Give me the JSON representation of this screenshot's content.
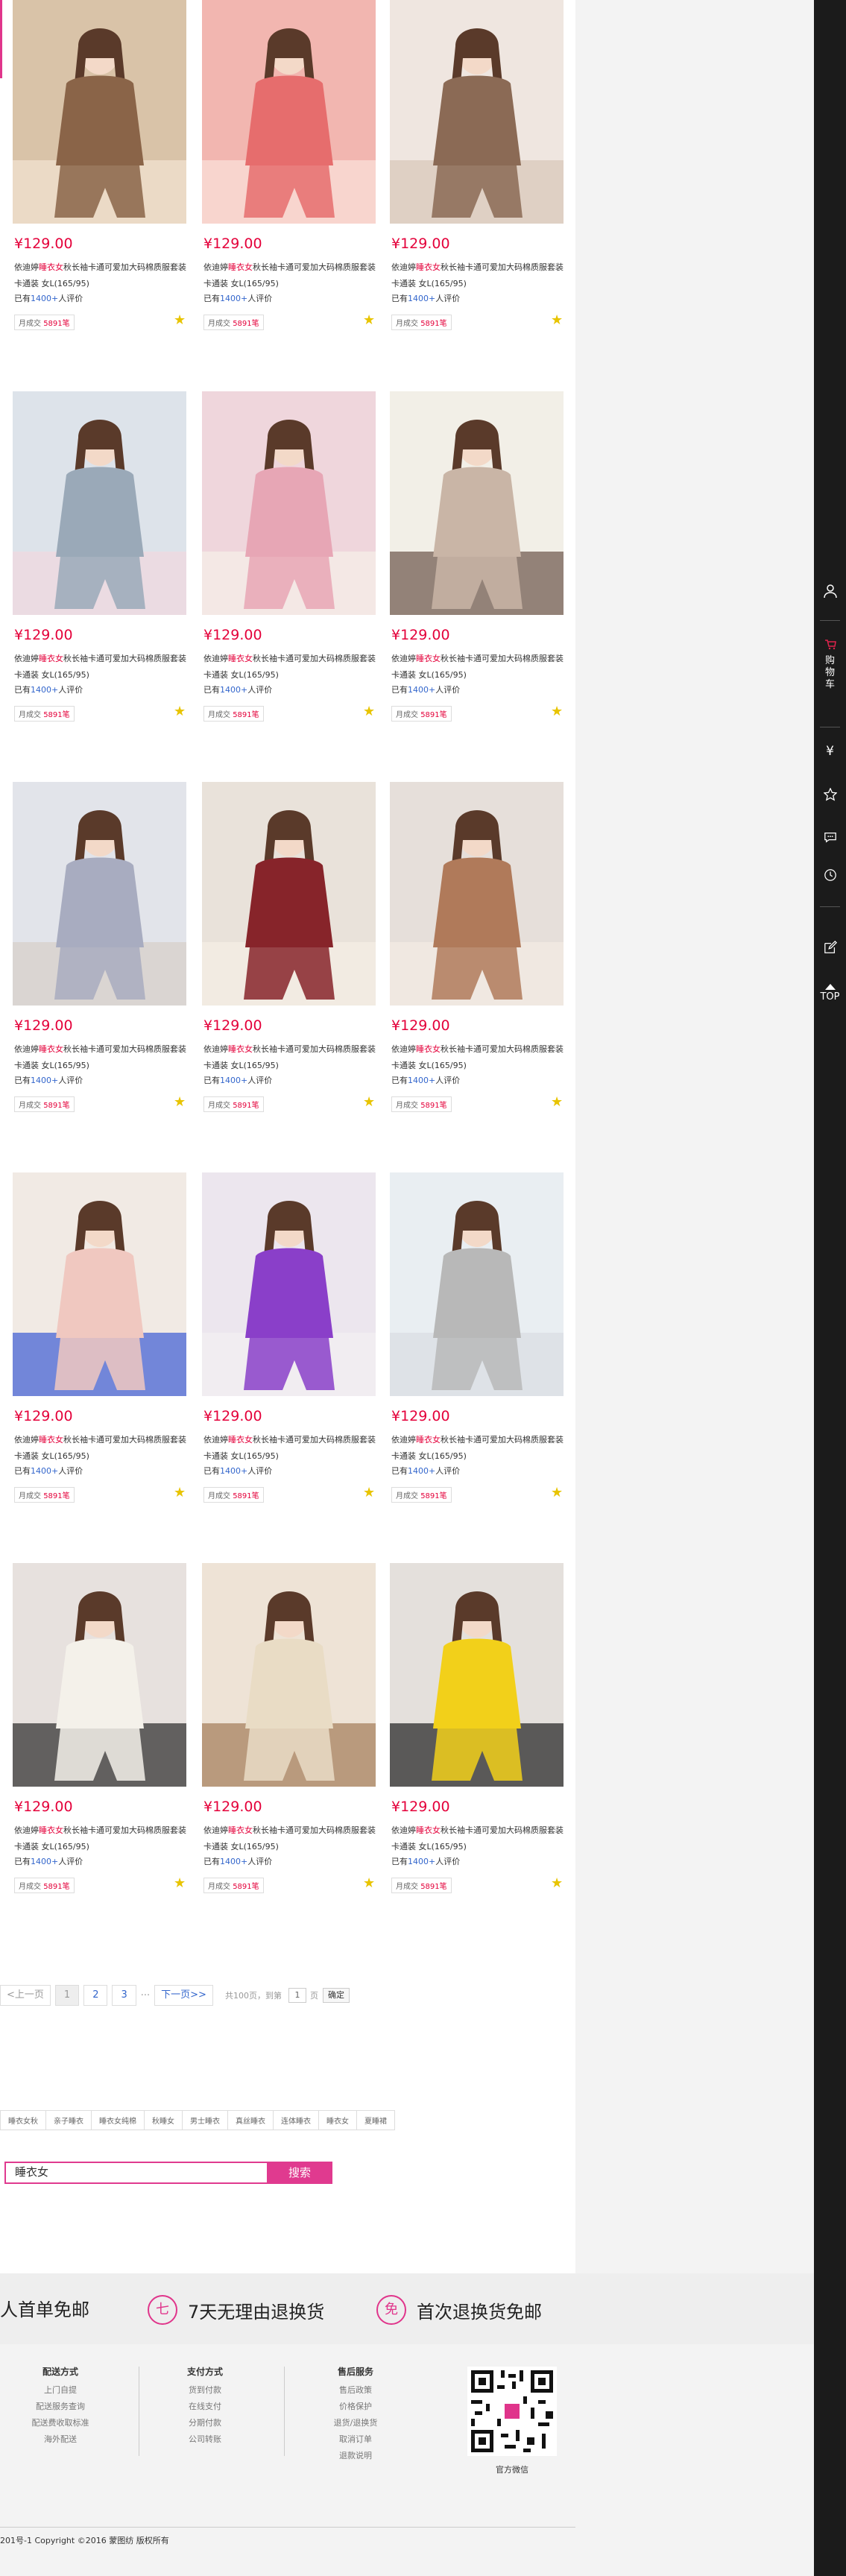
{
  "products": [
    {
      "price": "¥129.00",
      "desc_pre": "依迪婷",
      "desc_hl": "睡衣女",
      "desc_post": "秋长袖卡通可爱加大码棉质服套装 卡通装 女L(165/95)",
      "reviews_pre": "已有",
      "reviews_num": "1400+",
      "reviews_post": "人评价",
      "sold_label": "月成交",
      "sold_num": "5891笔"
    },
    {
      "price": "¥129.00",
      "desc_pre": "依迪婷",
      "desc_hl": "睡衣女",
      "desc_post": "秋长袖卡通可爱加大码棉质服套装 卡通装 女L(165/95)",
      "reviews_pre": "已有",
      "reviews_num": "1400+",
      "reviews_post": "人评价",
      "sold_label": "月成交",
      "sold_num": "5891笔"
    },
    {
      "price": "¥129.00",
      "desc_pre": "依迪婷",
      "desc_hl": "睡衣女",
      "desc_post": "秋长袖卡通可爱加大码棉质服套装 卡通装 女L(165/95)",
      "reviews_pre": "已有",
      "reviews_num": "1400+",
      "reviews_post": "人评价",
      "sold_label": "月成交",
      "sold_num": "5891笔"
    },
    {
      "price": "¥129.00",
      "desc_pre": "依迪婷",
      "desc_hl": "睡衣女",
      "desc_post": "秋长袖卡通可爱加大码棉质服套装 卡通装 女L(165/95)",
      "reviews_pre": "已有",
      "reviews_num": "1400+",
      "reviews_post": "人评价",
      "sold_label": "月成交",
      "sold_num": "5891笔"
    },
    {
      "price": "¥129.00",
      "desc_pre": "依迪婷",
      "desc_hl": "睡衣女",
      "desc_post": "秋长袖卡通可爱加大码棉质服套装 卡通装 女L(165/95)",
      "reviews_pre": "已有",
      "reviews_num": "1400+",
      "reviews_post": "人评价",
      "sold_label": "月成交",
      "sold_num": "5891笔"
    },
    {
      "price": "¥129.00",
      "desc_pre": "依迪婷",
      "desc_hl": "睡衣女",
      "desc_post": "秋长袖卡通可爱加大码棉质服套装 卡通装 女L(165/95)",
      "reviews_pre": "已有",
      "reviews_num": "1400+",
      "reviews_post": "人评价",
      "sold_label": "月成交",
      "sold_num": "5891笔"
    },
    {
      "price": "¥129.00",
      "desc_pre": "依迪婷",
      "desc_hl": "睡衣女",
      "desc_post": "秋长袖卡通可爱加大码棉质服套装 卡通装 女L(165/95)",
      "reviews_pre": "已有",
      "reviews_num": "1400+",
      "reviews_post": "人评价",
      "sold_label": "月成交",
      "sold_num": "5891笔"
    },
    {
      "price": "¥129.00",
      "desc_pre": "依迪婷",
      "desc_hl": "睡衣女",
      "desc_post": "秋长袖卡通可爱加大码棉质服套装 卡通装 女L(165/95)",
      "reviews_pre": "已有",
      "reviews_num": "1400+",
      "reviews_post": "人评价",
      "sold_label": "月成交",
      "sold_num": "5891笔"
    },
    {
      "price": "¥129.00",
      "desc_pre": "依迪婷",
      "desc_hl": "睡衣女",
      "desc_post": "秋长袖卡通可爱加大码棉质服套装 卡通装 女L(165/95)",
      "reviews_pre": "已有",
      "reviews_num": "1400+",
      "reviews_post": "人评价",
      "sold_label": "月成交",
      "sold_num": "5891笔"
    },
    {
      "price": "¥129.00",
      "desc_pre": "依迪婷",
      "desc_hl": "睡衣女",
      "desc_post": "秋长袖卡通可爱加大码棉质服套装 卡通装 女L(165/95)",
      "reviews_pre": "已有",
      "reviews_num": "1400+",
      "reviews_post": "人评价",
      "sold_label": "月成交",
      "sold_num": "5891笔"
    },
    {
      "price": "¥129.00",
      "desc_pre": "依迪婷",
      "desc_hl": "睡衣女",
      "desc_post": "秋长袖卡通可爱加大码棉质服套装 卡通装 女L(165/95)",
      "reviews_pre": "已有",
      "reviews_num": "1400+",
      "reviews_post": "人评价",
      "sold_label": "月成交",
      "sold_num": "5891笔"
    },
    {
      "price": "¥129.00",
      "desc_pre": "依迪婷",
      "desc_hl": "睡衣女",
      "desc_post": "秋长袖卡通可爱加大码棉质服套装 卡通装 女L(165/95)",
      "reviews_pre": "已有",
      "reviews_num": "1400+",
      "reviews_post": "人评价",
      "sold_label": "月成交",
      "sold_num": "5891笔"
    },
    {
      "price": "¥129.00",
      "desc_pre": "依迪婷",
      "desc_hl": "睡衣女",
      "desc_post": "秋长袖卡通可爱加大码棉质服套装 卡通装 女L(165/95)",
      "reviews_pre": "已有",
      "reviews_num": "1400+",
      "reviews_post": "人评价",
      "sold_label": "月成交",
      "sold_num": "5891笔"
    },
    {
      "price": "¥129.00",
      "desc_pre": "依迪婷",
      "desc_hl": "睡衣女",
      "desc_post": "秋长袖卡通可爱加大码棉质服套装 卡通装 女L(165/95)",
      "reviews_pre": "已有",
      "reviews_num": "1400+",
      "reviews_post": "人评价",
      "sold_label": "月成交",
      "sold_num": "5891笔"
    },
    {
      "price": "¥129.00",
      "desc_pre": "依迪婷",
      "desc_hl": "睡衣女",
      "desc_post": "秋长袖卡通可爱加大码棉质服套装 卡通装 女L(165/95)",
      "reviews_pre": "已有",
      "reviews_num": "1400+",
      "reviews_post": "人评价",
      "sold_label": "月成交",
      "sold_num": "5891笔"
    }
  ],
  "colors": {
    "price": "#e4003a",
    "accent": "#e0358b",
    "link": "#3366cc",
    "star": "#e8c400",
    "toolbar": "#1b1b1b"
  },
  "toolbar": {
    "cart_label": "购物车",
    "top_label": "TOP",
    "icons": [
      "user-icon",
      "cart-icon",
      "yen-icon",
      "star-icon",
      "chat-icon",
      "history-icon",
      "edit-icon",
      "top-icon"
    ]
  },
  "pagination": {
    "prev": "<上一页",
    "pages": [
      "1",
      "2",
      "3"
    ],
    "ellipsis": "···",
    "next": "下一页>>",
    "total": "共100页，到第",
    "page_value": "1",
    "page_unit": "页",
    "go": "确定"
  },
  "tags": [
    "睡衣女秋",
    "亲子睡衣",
    "睡衣女纯棉",
    "秋睡女",
    "男士睡衣",
    "真丝睡衣",
    "连体睡衣",
    "睡衣女",
    "夏睡裙"
  ],
  "search": {
    "value": "睡衣女",
    "button": "搜索"
  },
  "guarantees": [
    {
      "icon": "",
      "text": "人首单免邮"
    },
    {
      "icon": "七",
      "text": "7天无理由退换货"
    },
    {
      "icon": "免",
      "text": "首次退换货免邮"
    }
  ],
  "footer": {
    "columns": [
      {
        "title": "配送方式",
        "items": [
          "上门自提",
          "配送服务查询",
          "配送费收取标准",
          "海外配送"
        ]
      },
      {
        "title": "支付方式",
        "items": [
          "货到付款",
          "在线支付",
          "分期付款",
          "公司转账"
        ]
      },
      {
        "title": "售后服务",
        "items": [
          "售后政策",
          "价格保护",
          "退货/退换货",
          "取消订单",
          "退款说明"
        ]
      }
    ],
    "qr_label": "官方微信",
    "copyright": "201号-1 Copyright ©2016 蒙图纺 版权所有"
  }
}
